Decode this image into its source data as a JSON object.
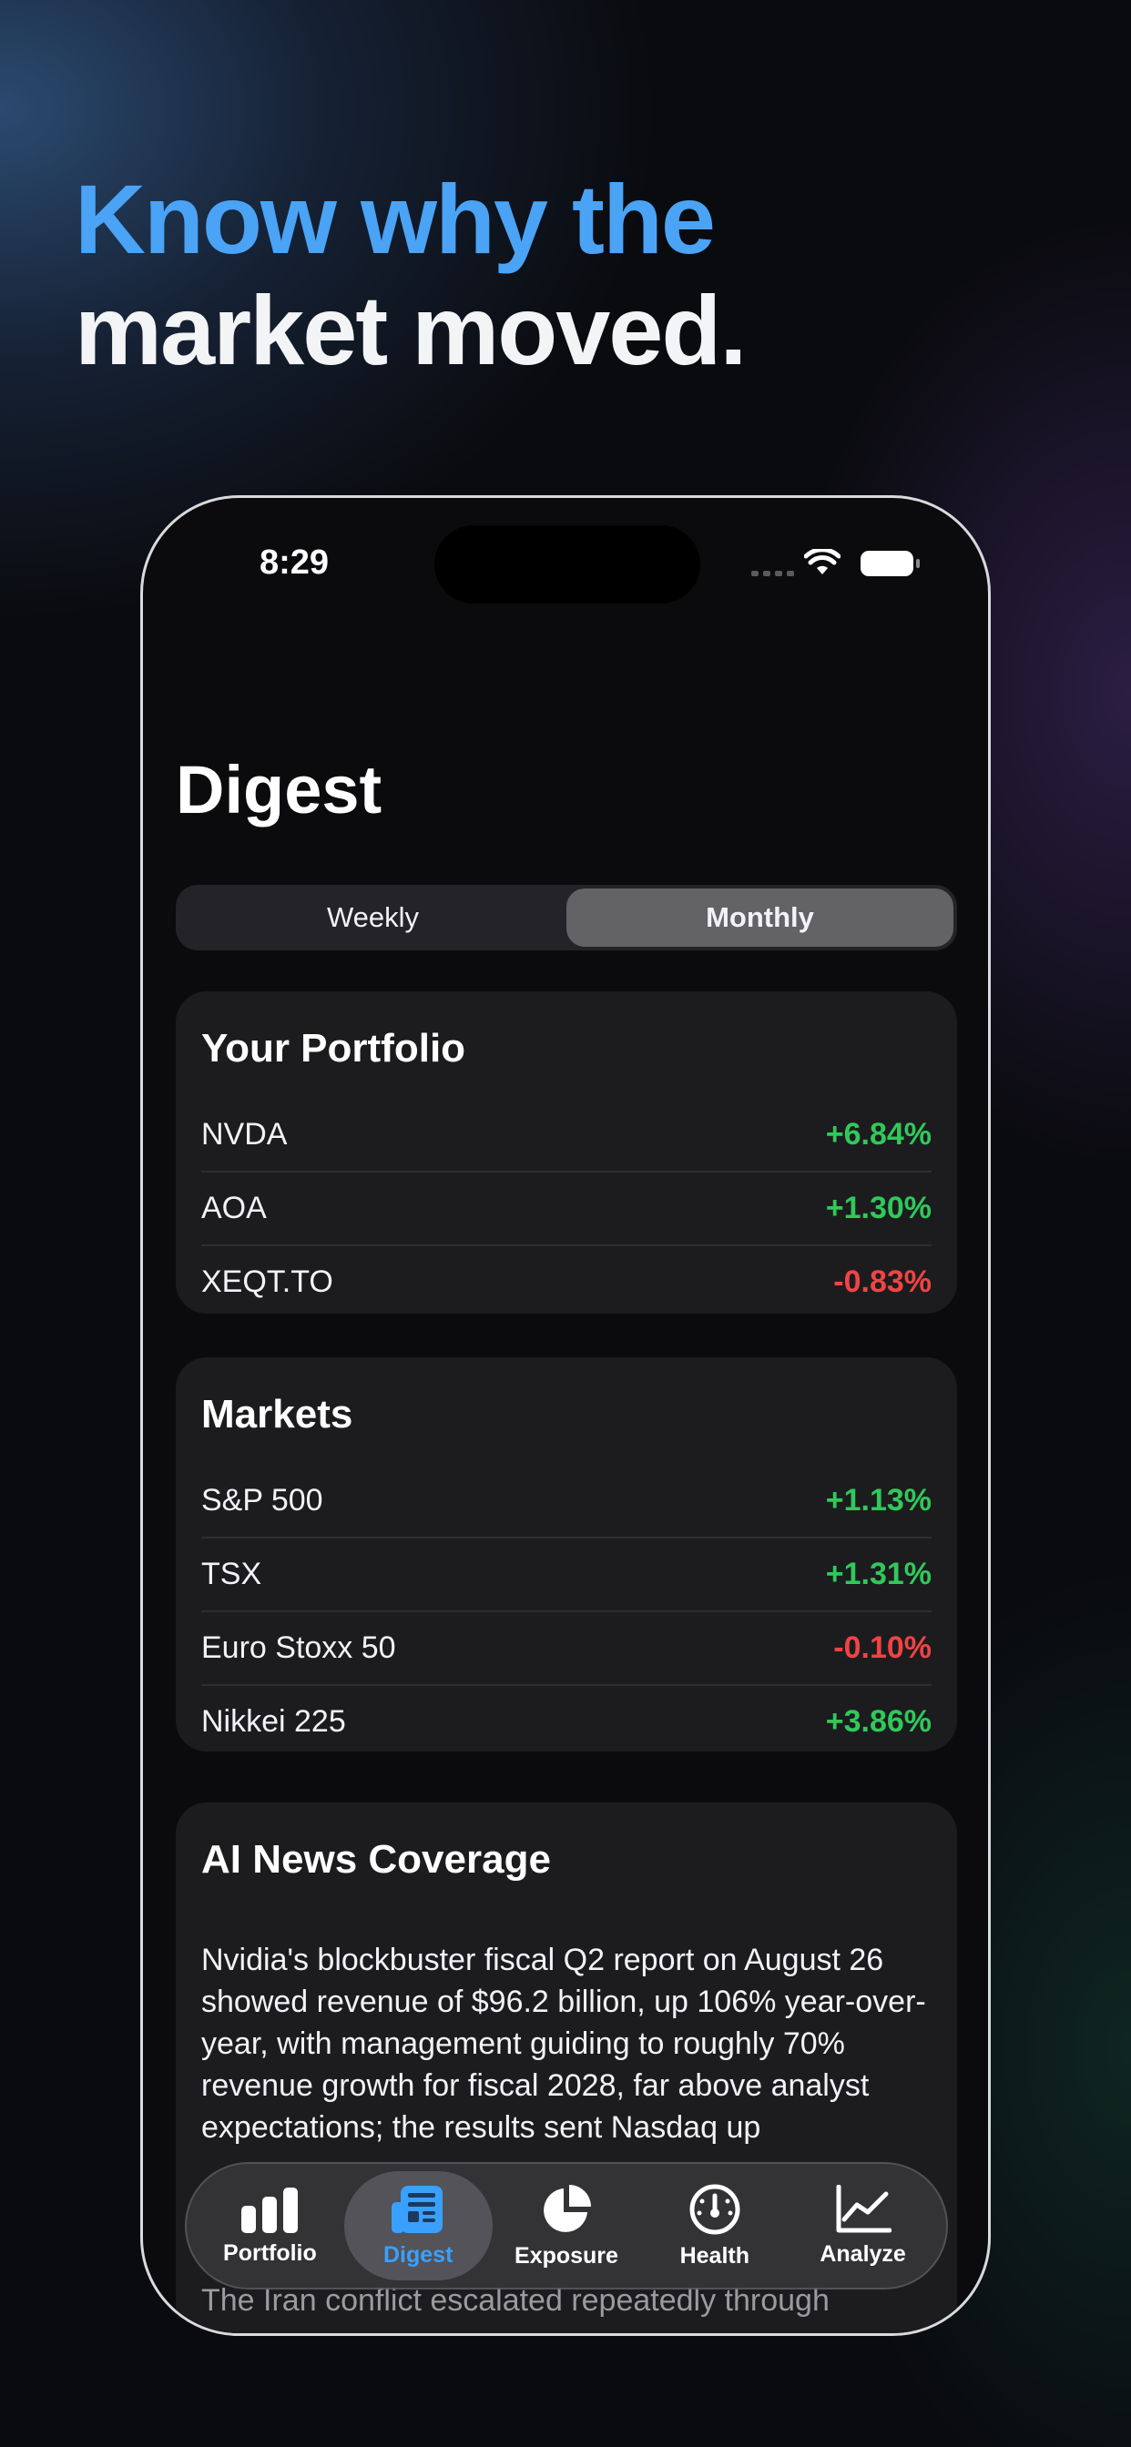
{
  "headline": {
    "line1": "Know why the",
    "line2": "market moved."
  },
  "status_bar": {
    "time": "8:29"
  },
  "page_title": "Digest",
  "segmented": {
    "options": [
      "Weekly",
      "Monthly"
    ],
    "selected": "Monthly"
  },
  "portfolio": {
    "title": "Your Portfolio",
    "rows": [
      {
        "name": "NVDA",
        "change": "+6.84%"
      },
      {
        "name": "AOA",
        "change": "+1.30%"
      },
      {
        "name": "XEQT.TO",
        "change": "-0.83%"
      }
    ]
  },
  "markets": {
    "title": "Markets",
    "rows": [
      {
        "name": "S&P 500",
        "change": "+1.13%"
      },
      {
        "name": "TSX",
        "change": "+1.31%"
      },
      {
        "name": "Euro Stoxx 50",
        "change": "-0.10%"
      },
      {
        "name": "Nikkei 225",
        "change": "+3.86%"
      }
    ]
  },
  "news": {
    "title": "AI News Coverage",
    "body": "Nvidia's blockbuster fiscal Q2 report on August 26 showed revenue of $96.2 billion, up 106% year-over-year, with management guiding to roughly 70% revenue growth for fiscal 2028, far above analyst expectations; the results sent Nasdaq up",
    "body2": "The Iran conflict escalated repeatedly through"
  },
  "tab_bar": {
    "tabs": [
      {
        "label": "Portfolio",
        "icon": "bar-chart-icon"
      },
      {
        "label": "Digest",
        "icon": "newspaper-icon"
      },
      {
        "label": "Exposure",
        "icon": "pie-chart-icon"
      },
      {
        "label": "Health",
        "icon": "gauge-icon"
      },
      {
        "label": "Analyze",
        "icon": "line-chart-icon"
      }
    ],
    "selected": "Digest"
  },
  "colors": {
    "accent": "#3aa0ff",
    "headline_accent": "#4aa3f5",
    "positive": "#30c95a",
    "negative": "#f04444"
  }
}
